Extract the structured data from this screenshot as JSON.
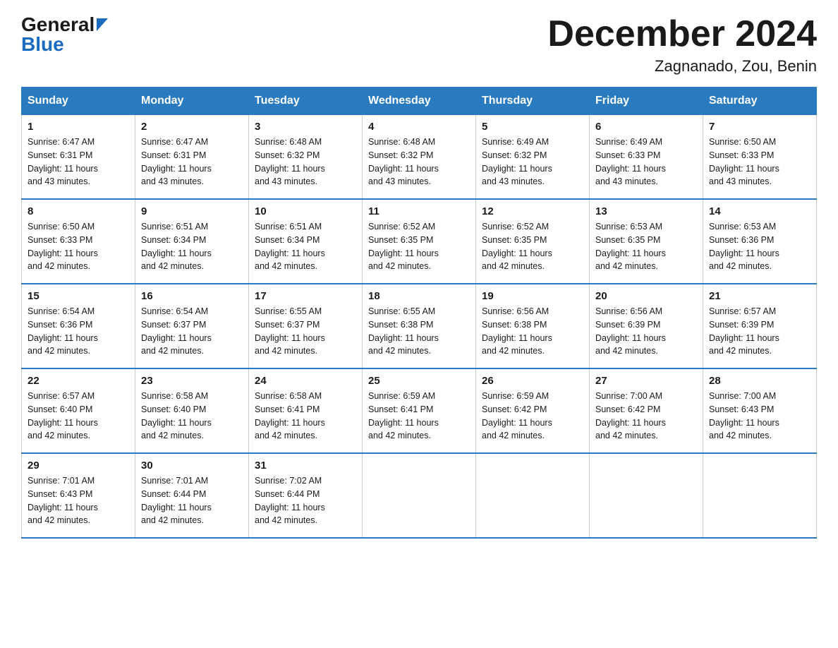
{
  "header": {
    "logo_general": "General",
    "logo_blue": "Blue",
    "month_title": "December 2024",
    "location": "Zagnanado, Zou, Benin"
  },
  "weekdays": [
    "Sunday",
    "Monday",
    "Tuesday",
    "Wednesday",
    "Thursday",
    "Friday",
    "Saturday"
  ],
  "weeks": [
    [
      {
        "day": "1",
        "sunrise": "6:47 AM",
        "sunset": "6:31 PM",
        "daylight": "11 hours and 43 minutes."
      },
      {
        "day": "2",
        "sunrise": "6:47 AM",
        "sunset": "6:31 PM",
        "daylight": "11 hours and 43 minutes."
      },
      {
        "day": "3",
        "sunrise": "6:48 AM",
        "sunset": "6:32 PM",
        "daylight": "11 hours and 43 minutes."
      },
      {
        "day": "4",
        "sunrise": "6:48 AM",
        "sunset": "6:32 PM",
        "daylight": "11 hours and 43 minutes."
      },
      {
        "day": "5",
        "sunrise": "6:49 AM",
        "sunset": "6:32 PM",
        "daylight": "11 hours and 43 minutes."
      },
      {
        "day": "6",
        "sunrise": "6:49 AM",
        "sunset": "6:33 PM",
        "daylight": "11 hours and 43 minutes."
      },
      {
        "day": "7",
        "sunrise": "6:50 AM",
        "sunset": "6:33 PM",
        "daylight": "11 hours and 43 minutes."
      }
    ],
    [
      {
        "day": "8",
        "sunrise": "6:50 AM",
        "sunset": "6:33 PM",
        "daylight": "11 hours and 42 minutes."
      },
      {
        "day": "9",
        "sunrise": "6:51 AM",
        "sunset": "6:34 PM",
        "daylight": "11 hours and 42 minutes."
      },
      {
        "day": "10",
        "sunrise": "6:51 AM",
        "sunset": "6:34 PM",
        "daylight": "11 hours and 42 minutes."
      },
      {
        "day": "11",
        "sunrise": "6:52 AM",
        "sunset": "6:35 PM",
        "daylight": "11 hours and 42 minutes."
      },
      {
        "day": "12",
        "sunrise": "6:52 AM",
        "sunset": "6:35 PM",
        "daylight": "11 hours and 42 minutes."
      },
      {
        "day": "13",
        "sunrise": "6:53 AM",
        "sunset": "6:35 PM",
        "daylight": "11 hours and 42 minutes."
      },
      {
        "day": "14",
        "sunrise": "6:53 AM",
        "sunset": "6:36 PM",
        "daylight": "11 hours and 42 minutes."
      }
    ],
    [
      {
        "day": "15",
        "sunrise": "6:54 AM",
        "sunset": "6:36 PM",
        "daylight": "11 hours and 42 minutes."
      },
      {
        "day": "16",
        "sunrise": "6:54 AM",
        "sunset": "6:37 PM",
        "daylight": "11 hours and 42 minutes."
      },
      {
        "day": "17",
        "sunrise": "6:55 AM",
        "sunset": "6:37 PM",
        "daylight": "11 hours and 42 minutes."
      },
      {
        "day": "18",
        "sunrise": "6:55 AM",
        "sunset": "6:38 PM",
        "daylight": "11 hours and 42 minutes."
      },
      {
        "day": "19",
        "sunrise": "6:56 AM",
        "sunset": "6:38 PM",
        "daylight": "11 hours and 42 minutes."
      },
      {
        "day": "20",
        "sunrise": "6:56 AM",
        "sunset": "6:39 PM",
        "daylight": "11 hours and 42 minutes."
      },
      {
        "day": "21",
        "sunrise": "6:57 AM",
        "sunset": "6:39 PM",
        "daylight": "11 hours and 42 minutes."
      }
    ],
    [
      {
        "day": "22",
        "sunrise": "6:57 AM",
        "sunset": "6:40 PM",
        "daylight": "11 hours and 42 minutes."
      },
      {
        "day": "23",
        "sunrise": "6:58 AM",
        "sunset": "6:40 PM",
        "daylight": "11 hours and 42 minutes."
      },
      {
        "day": "24",
        "sunrise": "6:58 AM",
        "sunset": "6:41 PM",
        "daylight": "11 hours and 42 minutes."
      },
      {
        "day": "25",
        "sunrise": "6:59 AM",
        "sunset": "6:41 PM",
        "daylight": "11 hours and 42 minutes."
      },
      {
        "day": "26",
        "sunrise": "6:59 AM",
        "sunset": "6:42 PM",
        "daylight": "11 hours and 42 minutes."
      },
      {
        "day": "27",
        "sunrise": "7:00 AM",
        "sunset": "6:42 PM",
        "daylight": "11 hours and 42 minutes."
      },
      {
        "day": "28",
        "sunrise": "7:00 AM",
        "sunset": "6:43 PM",
        "daylight": "11 hours and 42 minutes."
      }
    ],
    [
      {
        "day": "29",
        "sunrise": "7:01 AM",
        "sunset": "6:43 PM",
        "daylight": "11 hours and 42 minutes."
      },
      {
        "day": "30",
        "sunrise": "7:01 AM",
        "sunset": "6:44 PM",
        "daylight": "11 hours and 42 minutes."
      },
      {
        "day": "31",
        "sunrise": "7:02 AM",
        "sunset": "6:44 PM",
        "daylight": "11 hours and 42 minutes."
      },
      null,
      null,
      null,
      null
    ]
  ],
  "labels": {
    "sunrise": "Sunrise:",
    "sunset": "Sunset:",
    "daylight": "Daylight:"
  }
}
